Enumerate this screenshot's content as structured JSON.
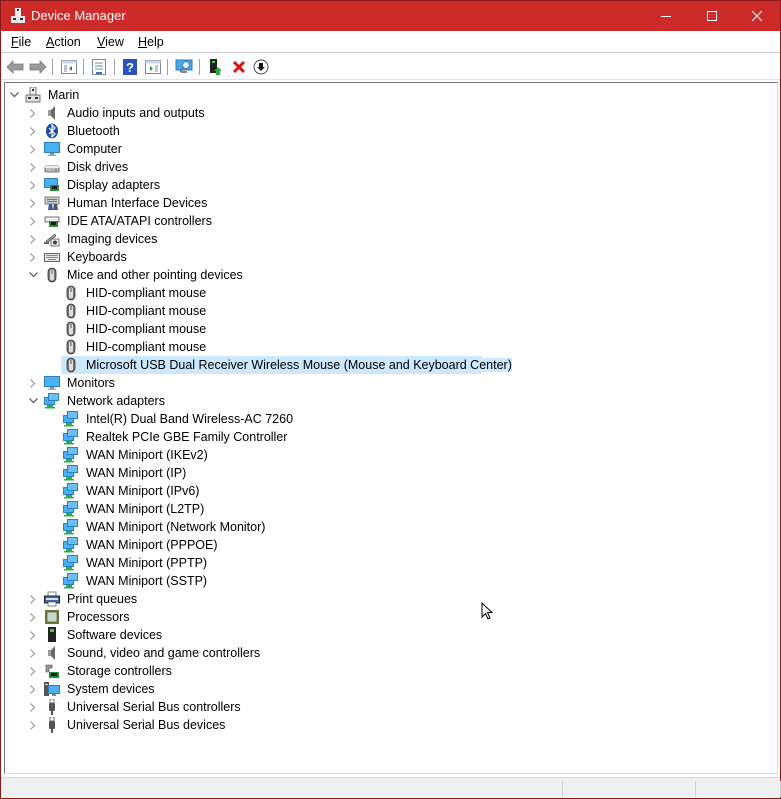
{
  "window": {
    "title": "Device Manager",
    "controls": {
      "minimize": "minimize",
      "maximize": "maximize",
      "close": "close"
    },
    "accent_color": "#cd2a2a"
  },
  "menubar": {
    "items": [
      {
        "label": "File",
        "accel": "F",
        "rest": "ile"
      },
      {
        "label": "Action",
        "accel": "A",
        "rest": "ction"
      },
      {
        "label": "View",
        "accel": "V",
        "rest": "iew"
      },
      {
        "label": "Help",
        "accel": "H",
        "rest": "elp"
      }
    ]
  },
  "toolbar": {
    "buttons": [
      {
        "name": "back",
        "icon": "arrow-left-icon",
        "enabled": false
      },
      {
        "name": "forward",
        "icon": "arrow-right-icon",
        "enabled": false
      },
      {
        "name": "show-hide-console-tree",
        "icon": "console-tree-icon"
      },
      {
        "name": "properties",
        "icon": "properties-icon"
      },
      {
        "name": "help",
        "icon": "help-icon"
      },
      {
        "name": "show-action-pane",
        "icon": "action-pane-icon"
      },
      {
        "name": "scan-hardware-changes",
        "icon": "scan-monitor-icon"
      },
      {
        "name": "update-driver",
        "icon": "update-driver-icon"
      },
      {
        "name": "uninstall-device",
        "icon": "uninstall-x-icon"
      },
      {
        "name": "disable-device",
        "icon": "disable-down-arrow-icon"
      }
    ]
  },
  "tree": {
    "root": {
      "label": "Marin",
      "icon": "computer-tower-icon",
      "expanded": true
    },
    "categories": [
      {
        "label": "Audio inputs and outputs",
        "icon": "speaker-icon",
        "expanded": false
      },
      {
        "label": "Bluetooth",
        "icon": "bluetooth-icon",
        "expanded": false
      },
      {
        "label": "Computer",
        "icon": "monitor-icon",
        "expanded": false
      },
      {
        "label": "Disk drives",
        "icon": "disk-drive-icon",
        "expanded": false
      },
      {
        "label": "Display adapters",
        "icon": "display-adapter-icon",
        "expanded": false
      },
      {
        "label": "Human Interface Devices",
        "icon": "hid-icon",
        "expanded": false
      },
      {
        "label": "IDE ATA/ATAPI controllers",
        "icon": "ide-controller-icon",
        "expanded": false
      },
      {
        "label": "Imaging devices",
        "icon": "camera-icon",
        "expanded": false
      },
      {
        "label": "Keyboards",
        "icon": "keyboard-icon",
        "expanded": false
      },
      {
        "label": "Mice and other pointing devices",
        "icon": "mouse-icon",
        "expanded": true,
        "children": [
          {
            "label": "HID-compliant mouse",
            "icon": "mouse-icon"
          },
          {
            "label": "HID-compliant mouse",
            "icon": "mouse-icon"
          },
          {
            "label": "HID-compliant mouse",
            "icon": "mouse-icon"
          },
          {
            "label": "HID-compliant mouse",
            "icon": "mouse-icon"
          },
          {
            "label": "Microsoft USB Dual Receiver Wireless Mouse (Mouse and Keyboard Center)",
            "icon": "mouse-icon",
            "selected": true
          }
        ]
      },
      {
        "label": "Monitors",
        "icon": "monitor-icon",
        "expanded": false
      },
      {
        "label": "Network adapters",
        "icon": "network-adapter-icon",
        "expanded": true,
        "children": [
          {
            "label": "Intel(R) Dual Band Wireless-AC 7260",
            "icon": "network-adapter-icon"
          },
          {
            "label": "Realtek PCIe GBE Family Controller",
            "icon": "network-adapter-icon"
          },
          {
            "label": "WAN Miniport (IKEv2)",
            "icon": "network-adapter-icon"
          },
          {
            "label": "WAN Miniport (IP)",
            "icon": "network-adapter-icon"
          },
          {
            "label": "WAN Miniport (IPv6)",
            "icon": "network-adapter-icon"
          },
          {
            "label": "WAN Miniport (L2TP)",
            "icon": "network-adapter-icon"
          },
          {
            "label": "WAN Miniport (Network Monitor)",
            "icon": "network-adapter-icon"
          },
          {
            "label": "WAN Miniport (PPPOE)",
            "icon": "network-adapter-icon"
          },
          {
            "label": "WAN Miniport (PPTP)",
            "icon": "network-adapter-icon"
          },
          {
            "label": "WAN Miniport (SSTP)",
            "icon": "network-adapter-icon"
          }
        ]
      },
      {
        "label": "Print queues",
        "icon": "printer-icon",
        "expanded": false
      },
      {
        "label": "Processors",
        "icon": "processor-icon",
        "expanded": false
      },
      {
        "label": "Software devices",
        "icon": "software-device-icon",
        "expanded": false
      },
      {
        "label": "Sound, video and game controllers",
        "icon": "speaker-icon",
        "expanded": false
      },
      {
        "label": "Storage controllers",
        "icon": "storage-controller-icon",
        "expanded": false
      },
      {
        "label": "System devices",
        "icon": "system-devices-icon",
        "expanded": false
      },
      {
        "label": "Universal Serial Bus controllers",
        "icon": "usb-icon",
        "expanded": false
      },
      {
        "label": "Universal Serial Bus devices",
        "icon": "usb-icon",
        "expanded": false
      }
    ]
  },
  "statusbar": {
    "panes": [
      "",
      "",
      ""
    ]
  },
  "colors": {
    "selection": "#cce8ff",
    "titlebar": "#cd2a2a"
  }
}
